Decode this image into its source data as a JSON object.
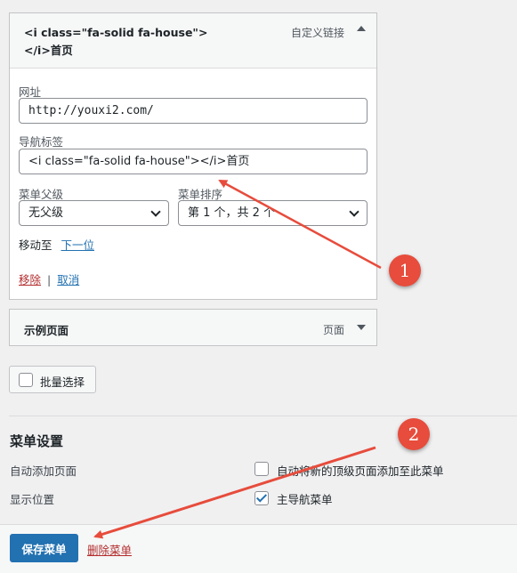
{
  "menu_items": [
    {
      "title": "<i class=\"fa-solid fa-house\"></i>首页",
      "type": "自定义链接",
      "url_label": "网址",
      "url_value": "http://youxi2.com/",
      "nav_label": "导航标签",
      "nav_value": "<i class=\"fa-solid fa-house\"></i>首页",
      "parent_label": "菜单父级",
      "parent_value": "无父级",
      "order_label": "菜单排序",
      "order_value": "第 1 个，共 2 个",
      "move_label": "移动至",
      "move_link": "下一位",
      "remove_link": "移除",
      "separator": "|",
      "cancel_link": "取消"
    },
    {
      "title": "示例页面",
      "type": "页面"
    }
  ],
  "bulk_select": "批量选择",
  "settings": {
    "title": "菜单设置",
    "auto_add_label": "自动添加页面",
    "auto_add_option": "自动将新的顶级页面添加至此菜单",
    "auto_add_checked": false,
    "location_label": "显示位置",
    "location_option": "主导航菜单",
    "location_checked": true
  },
  "footer": {
    "save_label": "保存菜单",
    "delete_label": "删除菜单"
  },
  "annotations": {
    "badge_1": "1",
    "badge_2": "2",
    "color": "#e74c3c"
  },
  "colors": {
    "primary": "#2271b1",
    "danger": "#b32d2e"
  }
}
